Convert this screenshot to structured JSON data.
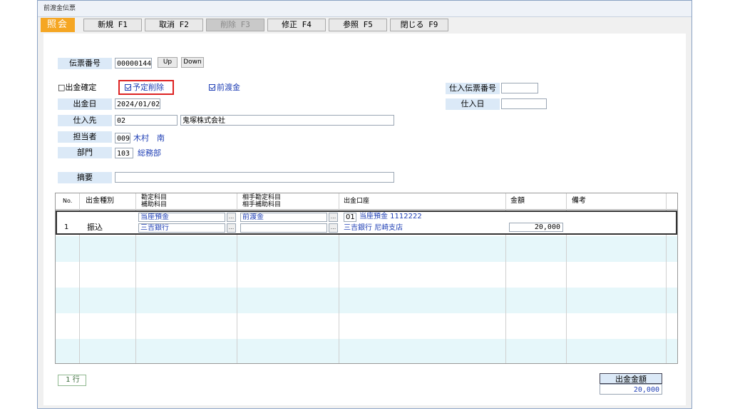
{
  "window": {
    "title": "前渡金伝票"
  },
  "toolbar": {
    "mode": "照会",
    "buttons": [
      "新規 F1",
      "取消 F2",
      "削除 F3",
      "修正 F4",
      "参照 F5",
      "閉じる F9"
    ]
  },
  "header": {
    "voucher_no_label": "伝票番号",
    "voucher_no_value": "00000144",
    "up_label": "Up",
    "down_label": "Down",
    "payment_confirm_label": "□出金確定",
    "scheduled_delete_label": "予定削除",
    "advance_label": "前渡金",
    "purchase_voucher_no_label": "仕入伝票番号",
    "purchase_voucher_no_value": "",
    "purchase_date_label": "仕入日",
    "purchase_date_value": "",
    "payment_date_label": "出金日",
    "payment_date_value": "2024/01/02",
    "supplier_label": "仕入先",
    "supplier_code": "02",
    "supplier_name": "鬼塚株式会社",
    "person_label": "担当者",
    "person_code": "009",
    "person_name": "木村　南",
    "dept_label": "部門",
    "dept_code": "103",
    "dept_name": "総務部",
    "memo_label": "摘要",
    "memo_value": ""
  },
  "grid": {
    "headers": {
      "no": "No.",
      "type": "出金種別",
      "account1": "勘定科目",
      "account2": "補助科目",
      "counter1": "相手勘定科目",
      "counter2": "相手補助科目",
      "bank_account": "出金口座",
      "amount": "金額",
      "note": "備考"
    },
    "row": {
      "no": "1",
      "type": "振込",
      "account": "当座預金",
      "sub_account": "三吉銀行",
      "counter_account": "前渡金",
      "counter_sub_account": "",
      "bank_code": "01",
      "bank_line1": "当座預金 1112222",
      "bank_line2": "三吉銀行 尼崎支店",
      "amount": "20,000",
      "note": ""
    },
    "ellipsis": "..."
  },
  "footer": {
    "row_count": "1 行",
    "total_label": "出金金額",
    "total_value": "20,000"
  },
  "colors": {
    "mode_bg": "#f5a623",
    "label_bg": "#dbe9f7",
    "stripe": "#e6f7fa",
    "highlight": "#d22222"
  }
}
